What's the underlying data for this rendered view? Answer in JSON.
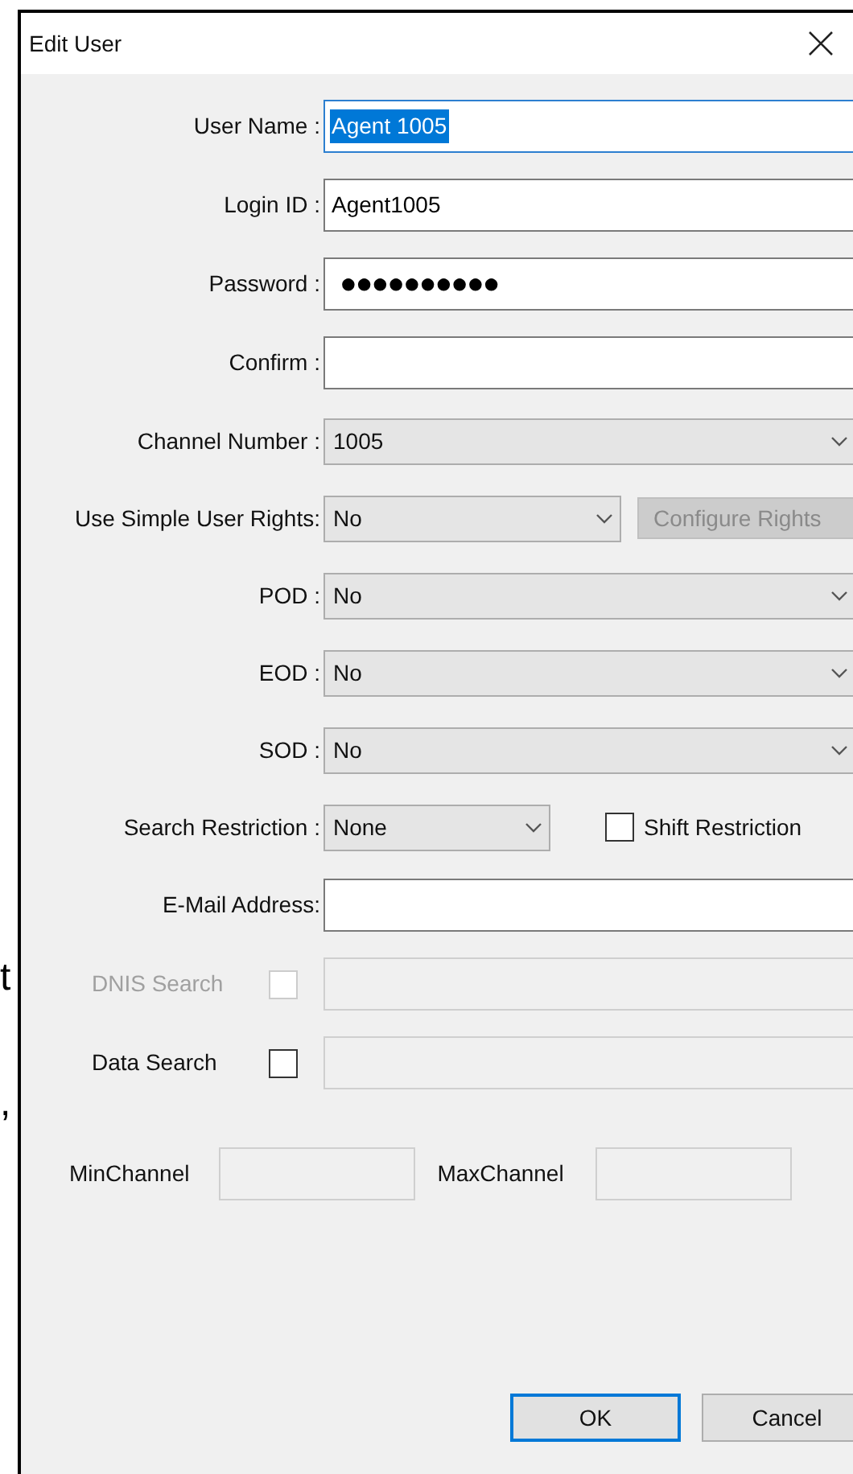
{
  "background_text": [
    "t",
    ","
  ],
  "window": {
    "title": "Edit User"
  },
  "fields": [
    {
      "kind": "text",
      "label": "User Name :",
      "value": "Agent 1005",
      "focused": true
    },
    {
      "kind": "text",
      "label": "Login ID :",
      "value": "Agent1005",
      "focused": false
    },
    {
      "kind": "password",
      "label": "Password :",
      "value": "●●●●●●●●●●",
      "focused": false
    },
    {
      "kind": "text",
      "label": "Confirm :",
      "focused": false
    },
    {
      "kind": "dropdown",
      "label": "Channel Number :",
      "value": "1005"
    },
    {
      "kind": "dropdown_button",
      "label": "Use Simple User Rights:",
      "value": "No",
      "button": {
        "label": "Configure Rights",
        "disabled": true
      }
    },
    {
      "kind": "dropdown",
      "label": "POD :",
      "value": "No"
    },
    {
      "kind": "dropdown",
      "label": "EOD :",
      "value": "No"
    },
    {
      "kind": "dropdown",
      "label": "SOD :",
      "value": "No"
    },
    {
      "kind": "dropdown_check",
      "label": "Search Restriction :",
      "value": "None",
      "check": {
        "label": "Shift Restriction",
        "checked": false
      }
    },
    {
      "kind": "text",
      "label": "E-Mail Address:",
      "focused": false
    },
    {
      "kind": "check_field",
      "label": "DNIS Search",
      "checked": false,
      "disabled": true
    },
    {
      "kind": "check_field",
      "label": "Data Search",
      "checked": false,
      "disabled": false
    }
  ],
  "range": [
    {
      "label": "MinChannel"
    },
    {
      "label": "MaxChannel"
    }
  ],
  "buttons": [
    {
      "label": "OK",
      "default": true
    },
    {
      "label": "Cancel",
      "default": false
    }
  ]
}
